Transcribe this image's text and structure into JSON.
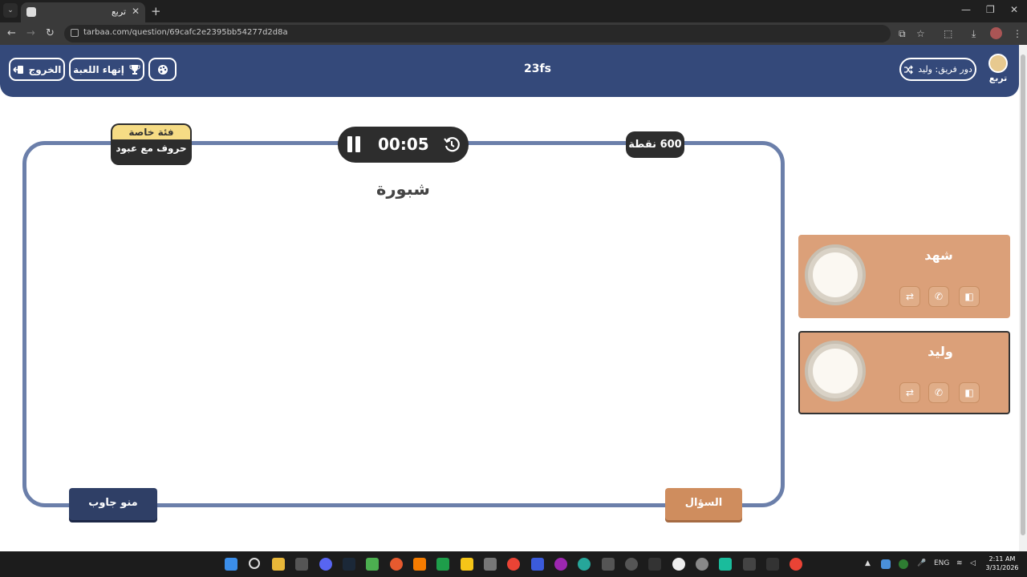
{
  "browser": {
    "tab_title": "تربع",
    "url": "tarbaa.com/question/69cafc2e2395bb54277d2d8a"
  },
  "header": {
    "exit_label": "الخروج",
    "end_game_label": "إنهاء اللعبة",
    "game_name": "23fs",
    "turn_label": "دور فريق: وليد",
    "logo_text": "تربع"
  },
  "board": {
    "timer": "00:05",
    "points": "600 نقطة",
    "category_tag": "فئة خاصة",
    "category_name": "حروف مع عبود",
    "answer": "شبورة",
    "who_answered_label": "منو جاوب",
    "question_label": "السؤال"
  },
  "teams": [
    {
      "name": "شهد",
      "active": false
    },
    {
      "name": "وليد",
      "active": true
    }
  ],
  "taskbar": {
    "lang": "ENG",
    "time": "2:11 AM",
    "date": "3/31/2026"
  },
  "colors": {
    "header": "#34497a",
    "board_border": "#6b7faa",
    "team_card": "#dba079",
    "question_button": "#cf8d5e",
    "who_button": "#2f3f66"
  }
}
